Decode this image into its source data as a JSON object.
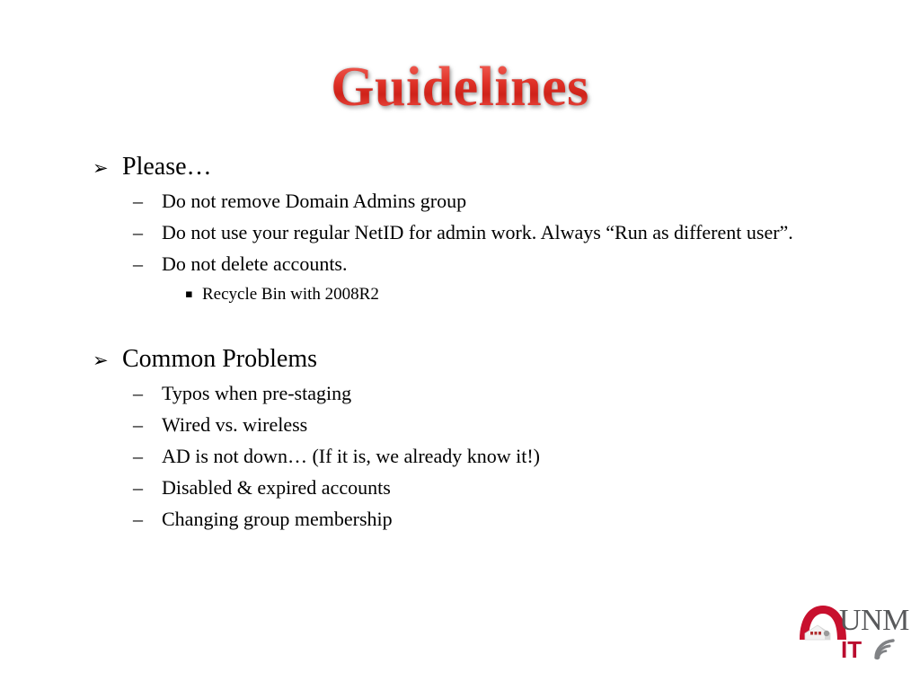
{
  "slide": {
    "title": "Guidelines",
    "title_color": "#e03228",
    "background_color": "#ffffff"
  },
  "bullets": {
    "arrow_glyph": "➢",
    "dash_glyph": "–",
    "square_glyph": "▪"
  },
  "sections": [
    {
      "heading": "Please…",
      "items": [
        {
          "level": 2,
          "text": "Do not remove Domain Admins group"
        },
        {
          "level": 2,
          "text": "Do not use your regular NetID for admin work.  Always “Run as different user”."
        },
        {
          "level": 2,
          "text": "Do not delete accounts."
        },
        {
          "level": 3,
          "text": "Recycle Bin with 2008R2"
        }
      ]
    },
    {
      "heading": "Common Problems",
      "items": [
        {
          "level": 2,
          "text": "Typos when pre-staging"
        },
        {
          "level": 2,
          "text": "Wired vs. wireless"
        },
        {
          "level": 2,
          "text": "AD is not down… (If it is, we already know it!)"
        },
        {
          "level": 2,
          "text": "Disabled & expired accounts"
        },
        {
          "level": 2,
          "text": "Changing group membership"
        }
      ]
    }
  ],
  "logo": {
    "unm_text": "UNM",
    "it_text": "IT",
    "arch_color": "#c8102e",
    "unm_text_color": "#58595b",
    "it_text_color": "#ba0c2f",
    "wifi_color": "#808285"
  }
}
